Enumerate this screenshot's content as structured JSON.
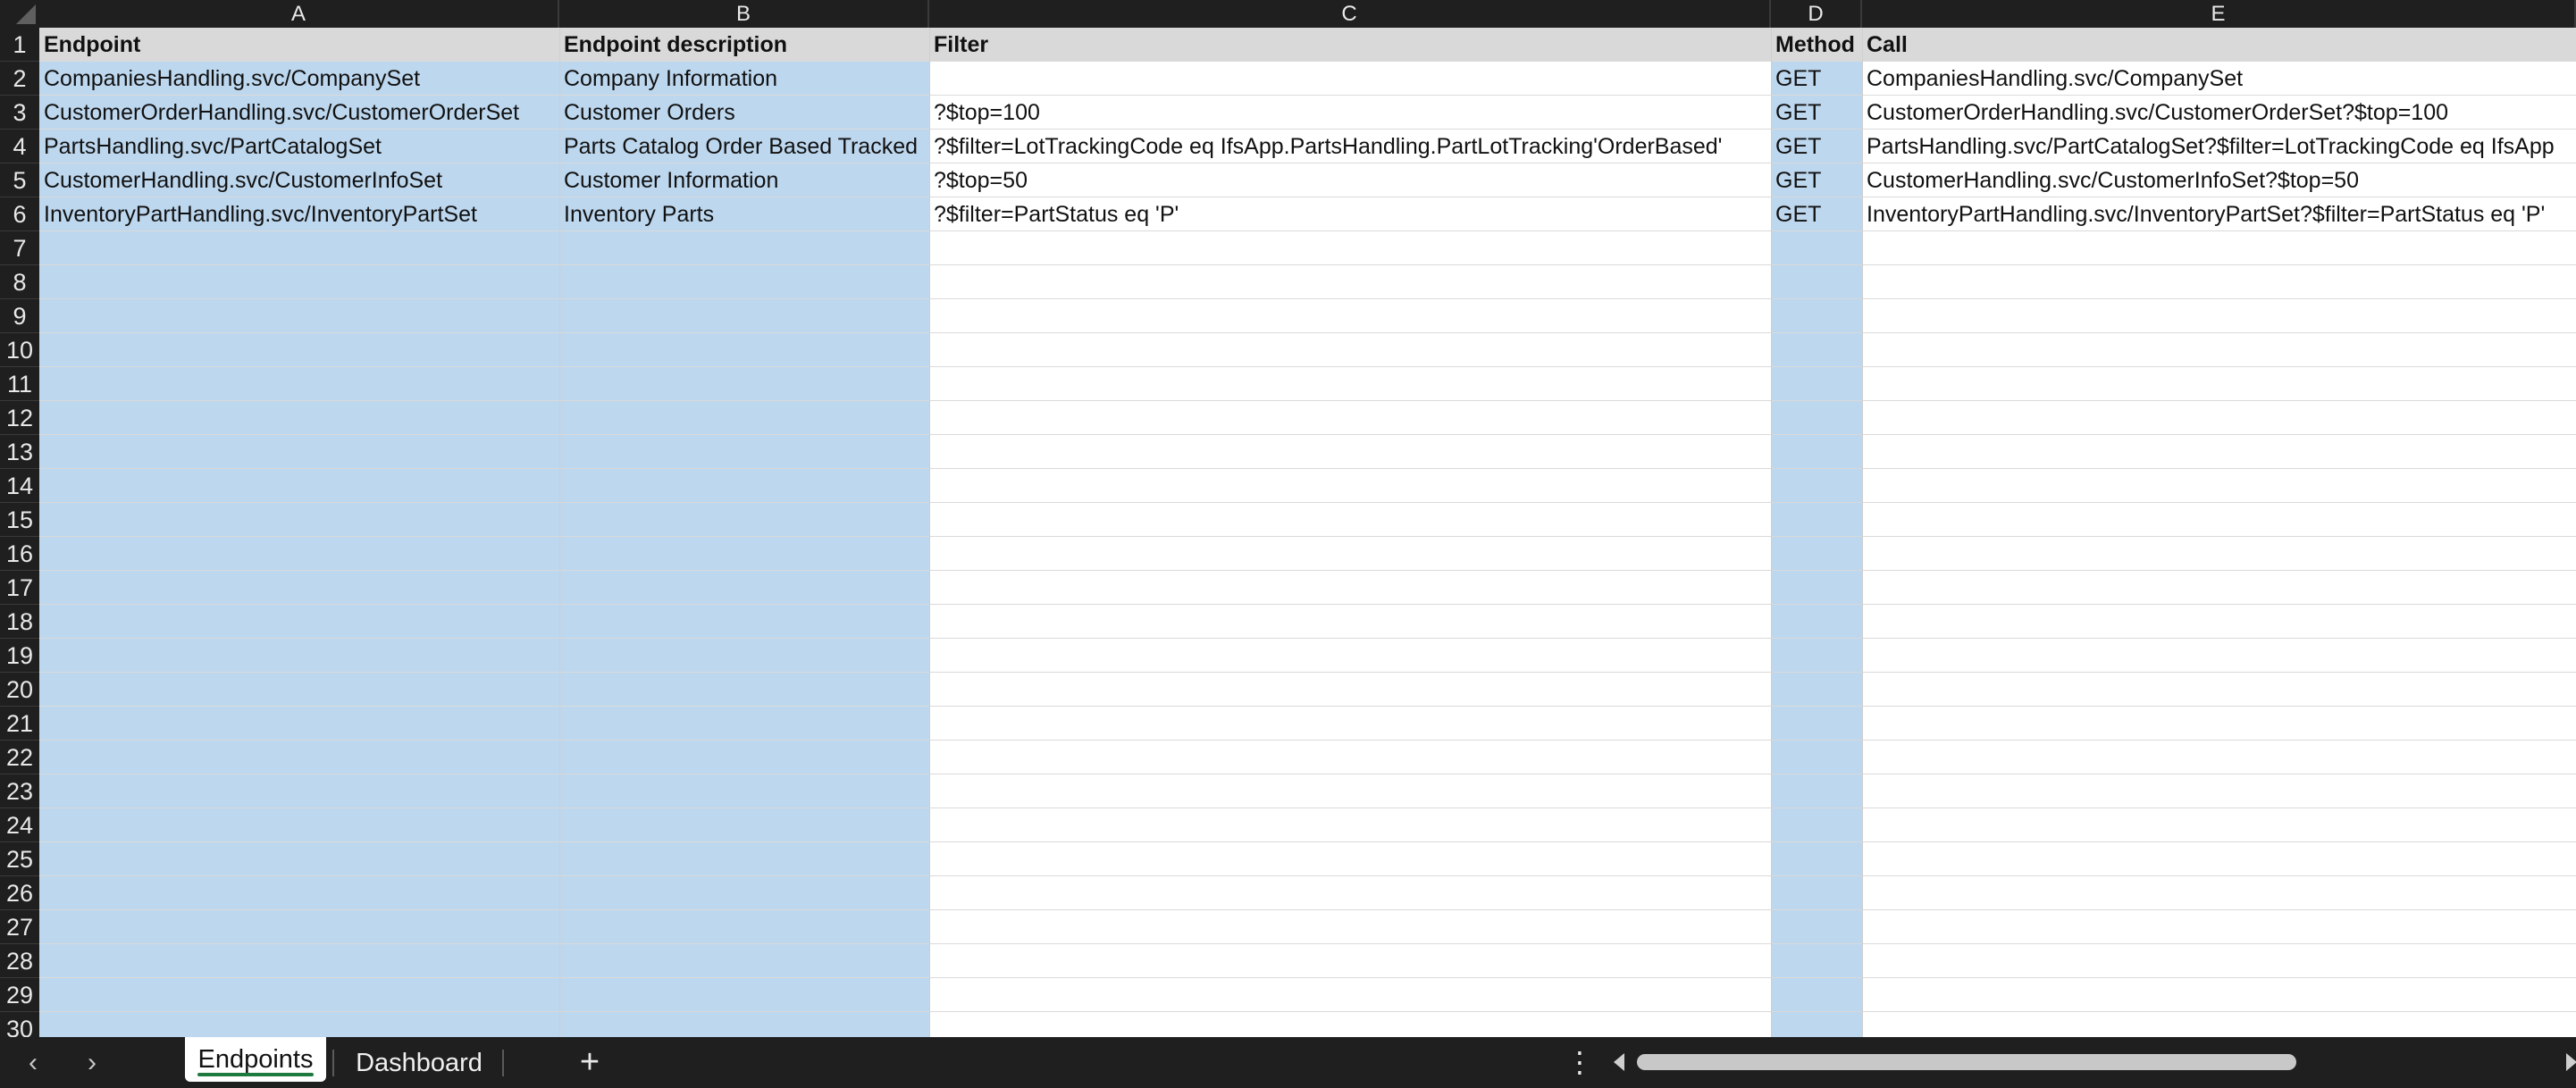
{
  "columns": [
    "A",
    "B",
    "C",
    "D",
    "E"
  ],
  "rows": [
    "1",
    "2",
    "3",
    "4",
    "5",
    "6",
    "7",
    "8",
    "9",
    "10",
    "11",
    "12",
    "13",
    "14",
    "15",
    "16",
    "17",
    "18",
    "19",
    "20",
    "21",
    "22",
    "23",
    "24",
    "25",
    "26",
    "27",
    "28",
    "29",
    "30"
  ],
  "headers": {
    "endpoint": "Endpoint",
    "description": "Endpoint description",
    "filter": "Filter",
    "method": "Method",
    "call": "Call"
  },
  "data_rows": [
    {
      "endpoint": "CompaniesHandling.svc/CompanySet",
      "description": "Company Information",
      "filter": "",
      "method": "GET",
      "call": "CompaniesHandling.svc/CompanySet"
    },
    {
      "endpoint": "CustomerOrderHandling.svc/CustomerOrderSet",
      "description": "Customer Orders",
      "filter": "?$top=100",
      "method": "GET",
      "call": "CustomerOrderHandling.svc/CustomerOrderSet?$top=100"
    },
    {
      "endpoint": "PartsHandling.svc/PartCatalogSet",
      "description": "Parts Catalog Order Based Tracked",
      "filter": "?$filter=LotTrackingCode eq IfsApp.PartsHandling.PartLotTracking'OrderBased'",
      "method": "GET",
      "call": "PartsHandling.svc/PartCatalogSet?$filter=LotTrackingCode eq IfsApp"
    },
    {
      "endpoint": "CustomerHandling.svc/CustomerInfoSet",
      "description": "Customer Information",
      "filter": "?$top=50",
      "method": "GET",
      "call": "CustomerHandling.svc/CustomerInfoSet?$top=50"
    },
    {
      "endpoint": "InventoryPartHandling.svc/InventoryPartSet",
      "description": "Inventory Parts",
      "filter": "?$filter=PartStatus eq 'P'",
      "method": "GET",
      "call": "InventoryPartHandling.svc/InventoryPartSet?$filter=PartStatus eq 'P'"
    }
  ],
  "tabs": {
    "active": "Endpoints",
    "inactive": "Dashboard",
    "add": "+"
  },
  "icons": {
    "prev": "chevron-left-icon",
    "next": "chevron-right-icon",
    "add": "plus-icon",
    "more": "more-vertical-icon"
  },
  "colors": {
    "highlight": "#bdd7ee",
    "header_fill": "#d9d9d9",
    "active_tab_accent": "#1f7a3e"
  }
}
